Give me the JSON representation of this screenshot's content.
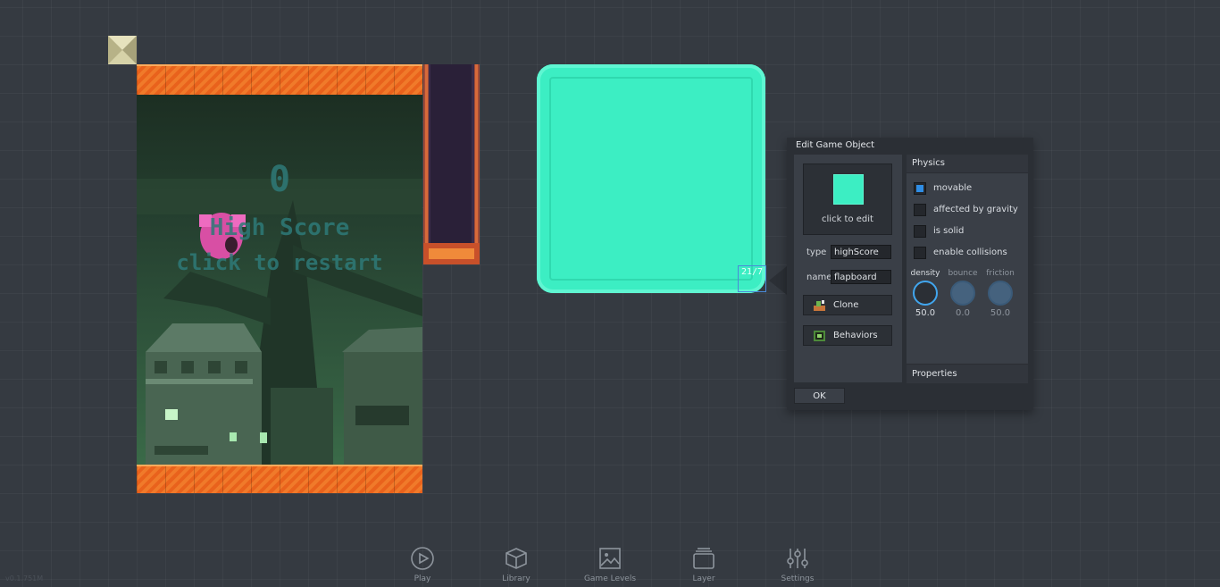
{
  "game": {
    "score": "0",
    "highscore_label": "High Score",
    "restart_label": "click to restart"
  },
  "selected_object": {
    "size_badge": "21/7",
    "color": "#3ceec3"
  },
  "edit_dialog": {
    "title": "Edit Game Object",
    "preview_caption": "click to edit",
    "type_label": "type",
    "type_value": "highScore",
    "name_label": "name",
    "name_value": "flapboard",
    "clone_label": "Clone",
    "behaviors_label": "Behaviors",
    "physics_header": "Physics",
    "checkboxes": [
      {
        "label": "movable",
        "checked": true
      },
      {
        "label": "affected by gravity",
        "checked": false
      },
      {
        "label": "is solid",
        "checked": false
      },
      {
        "label": "enable collisions",
        "checked": false
      }
    ],
    "knobs": [
      {
        "label": "density",
        "value": "50.0",
        "active": true
      },
      {
        "label": "bounce",
        "value": "0.0",
        "active": false
      },
      {
        "label": "friction",
        "value": "50.0",
        "active": false
      }
    ],
    "properties_header": "Properties",
    "ok_label": "OK"
  },
  "toolbar": {
    "play": "Play",
    "library": "Library",
    "game_levels": "Game Levels",
    "layer": "Layer",
    "settings": "Settings"
  },
  "version": "v0.1.751M"
}
